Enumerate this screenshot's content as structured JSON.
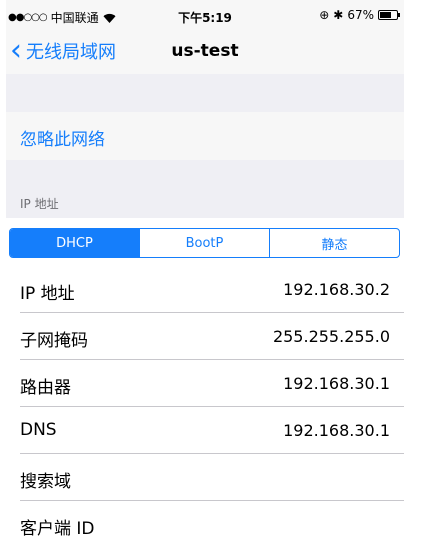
{
  "status_bar": {
    "carrier": "中国联通",
    "time": "下午5:19",
    "battery": "67%",
    "battery_level": 0.67
  },
  "nav": {
    "back_label": "无线局域网",
    "title": "us-test"
  },
  "forget_network": "忽略此网络",
  "section_header": "IP 地址",
  "segments": [
    "DHCP",
    "BootP",
    "静态"
  ],
  "selected_segment": "DHCP",
  "rows": [
    {
      "label": "IP 地址",
      "value": "192.168.30.2"
    },
    {
      "label": "子网掩码",
      "value": "255.255.255.0"
    },
    {
      "label": "路由器",
      "value": "192.168.30.1"
    },
    {
      "label": "DNS",
      "value": "192.168.30.1"
    },
    {
      "label": "搜索域",
      "value": ""
    },
    {
      "label": "客户端 ID",
      "value": ""
    }
  ],
  "colors": {
    "accent": "#157efb",
    "background": "#efeff4",
    "cell": "#ffffff"
  }
}
